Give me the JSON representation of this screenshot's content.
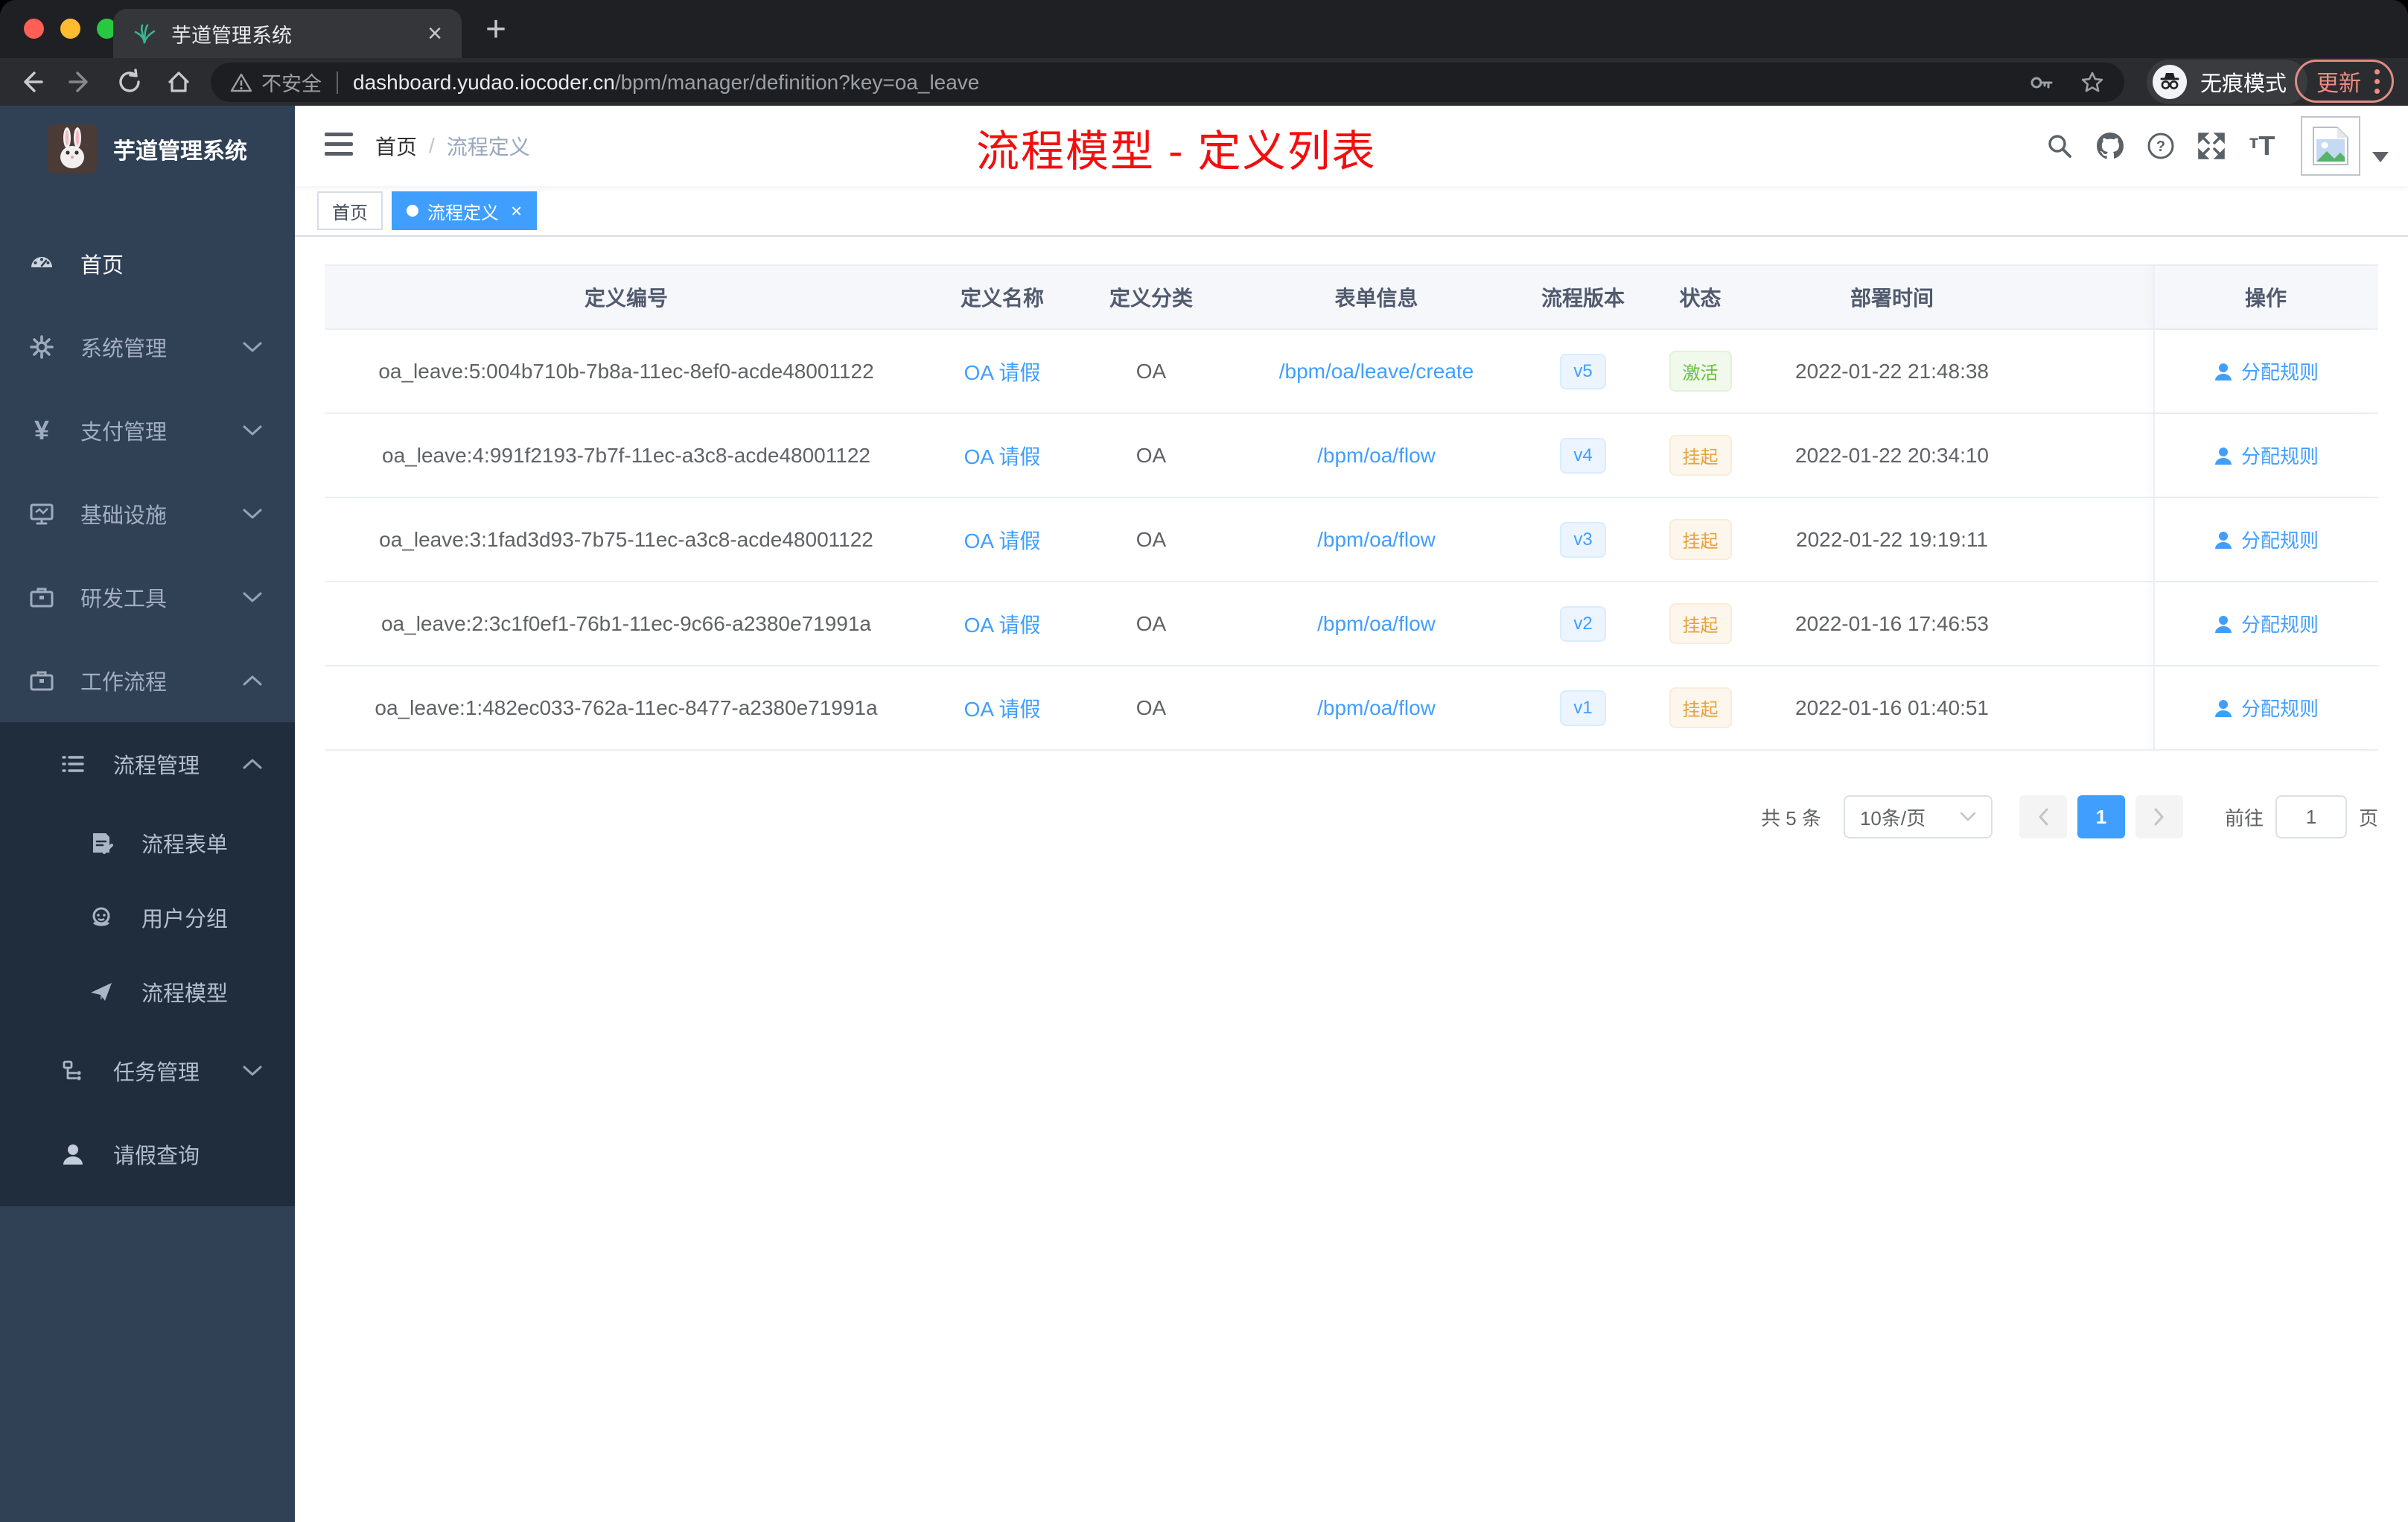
{
  "browser": {
    "tab_title": "芋道管理系统",
    "close_tab": "×",
    "new_tab": "+",
    "security_label": "不安全",
    "url_host": "dashboard.yudao.iocoder.cn",
    "url_path": "/bpm/manager/definition?key=oa_leave",
    "incognito_label": "无痕模式",
    "update_label": "更新"
  },
  "sidebar": {
    "logo_title": "芋道管理系统",
    "items": [
      {
        "label": "首页",
        "icon": "dashboard-icon"
      },
      {
        "label": "系统管理",
        "icon": "gear-icon",
        "chevron": "down"
      },
      {
        "label": "支付管理",
        "icon": "yen-icon",
        "chevron": "down"
      },
      {
        "label": "基础设施",
        "icon": "monitor-icon",
        "chevron": "down"
      },
      {
        "label": "研发工具",
        "icon": "briefcase-icon",
        "chevron": "down"
      },
      {
        "label": "工作流程",
        "icon": "briefcase-icon",
        "chevron": "up"
      },
      {
        "label": "流程管理",
        "icon": "list-icon",
        "chevron": "up"
      },
      {
        "label": "流程表单",
        "icon": "form-icon"
      },
      {
        "label": "用户分组",
        "icon": "robot-icon"
      },
      {
        "label": "流程模型",
        "icon": "plane-icon"
      },
      {
        "label": "任务管理",
        "icon": "flow-icon",
        "chevron": "down"
      },
      {
        "label": "请假查询",
        "icon": "user-icon"
      }
    ]
  },
  "header": {
    "breadcrumb": {
      "home": "首页",
      "separator": "/",
      "current": "流程定义"
    },
    "annotation": "流程模型 - 定义列表",
    "icons": [
      "search-icon",
      "github-icon",
      "help-icon",
      "fullscreen-icon",
      "font-size-icon"
    ],
    "font_size_small": "т",
    "font_size_big": "T"
  },
  "tags": {
    "home": "首页",
    "active": "流程定义",
    "close": "×"
  },
  "table": {
    "columns": [
      "定义编号",
      "定义名称",
      "定义分类",
      "表单信息",
      "流程版本",
      "状态",
      "部署时间",
      "操作"
    ],
    "rows": [
      {
        "id": "oa_leave:5:004b710b-7b8a-11ec-8ef0-acde48001122",
        "name": "OA 请假",
        "category": "OA",
        "form": "/bpm/oa/leave/create",
        "version": "v5",
        "status": "激活",
        "status_type": "success",
        "time": "2022-01-22 21:48:38",
        "action": "分配规则"
      },
      {
        "id": "oa_leave:4:991f2193-7b7f-11ec-a3c8-acde48001122",
        "name": "OA 请假",
        "category": "OA",
        "form": "/bpm/oa/flow",
        "version": "v4",
        "status": "挂起",
        "status_type": "warning",
        "time": "2022-01-22 20:34:10",
        "action": "分配规则"
      },
      {
        "id": "oa_leave:3:1fad3d93-7b75-11ec-a3c8-acde48001122",
        "name": "OA 请假",
        "category": "OA",
        "form": "/bpm/oa/flow",
        "version": "v3",
        "status": "挂起",
        "status_type": "warning",
        "time": "2022-01-22 19:19:11",
        "action": "分配规则"
      },
      {
        "id": "oa_leave:2:3c1f0ef1-76b1-11ec-9c66-a2380e71991a",
        "name": "OA 请假",
        "category": "OA",
        "form": "/bpm/oa/flow",
        "version": "v2",
        "status": "挂起",
        "status_type": "warning",
        "time": "2022-01-16 17:46:53",
        "action": "分配规则"
      },
      {
        "id": "oa_leave:1:482ec033-762a-11ec-8477-a2380e71991a",
        "name": "OA 请假",
        "category": "OA",
        "form": "/bpm/oa/flow",
        "version": "v1",
        "status": "挂起",
        "status_type": "warning",
        "time": "2022-01-16 01:40:51",
        "action": "分配规则"
      }
    ]
  },
  "pagination": {
    "total": "共 5 条",
    "page_size": "10条/页",
    "page": "1",
    "goto": "前往",
    "goto_value": "1",
    "unit": "页"
  },
  "colors": {
    "accent": "#409eff",
    "annotation_red": "#f50d0d",
    "success_green": "#67c23a",
    "warning_orange": "#e6a23c",
    "sidebar_bg": "#304156",
    "submenu_bg": "#1f2d3d"
  }
}
